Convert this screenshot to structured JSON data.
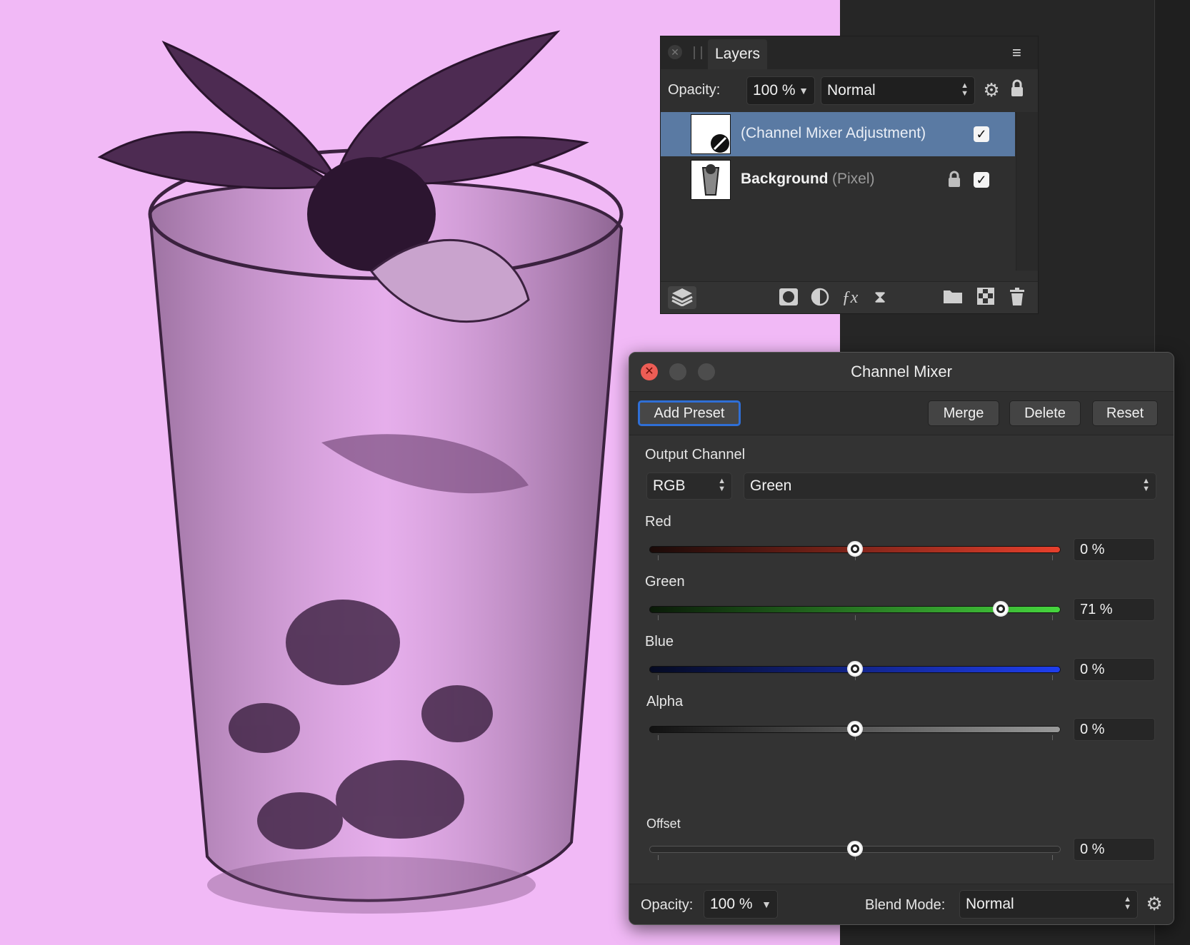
{
  "layers_panel": {
    "tab_label": "Layers",
    "opacity_label": "Opacity:",
    "opacity_value": "100 %",
    "blend_mode": "Normal",
    "layers": [
      {
        "name": "(Channel Mixer Adjustment)",
        "selected": true,
        "visible": true
      },
      {
        "name": "Background",
        "type": "(Pixel)",
        "selected": false,
        "locked": true,
        "visible": true
      }
    ],
    "footer_icons": [
      "layers-icon",
      "mask-icon",
      "adjustment-icon",
      "fx-icon",
      "live-filter-icon",
      "folder-icon",
      "pixel-layer-icon",
      "trash-icon"
    ]
  },
  "channel_mixer": {
    "title": "Channel Mixer",
    "buttons": {
      "add_preset": "Add Preset",
      "merge": "Merge",
      "delete": "Delete",
      "reset": "Reset"
    },
    "output_channel_label": "Output Channel",
    "color_space": "RGB",
    "channel": "Green",
    "sliders": [
      {
        "label": "Red",
        "value_text": "0 %",
        "value": 0,
        "colors": [
          "#1a0a08",
          "#e8402c"
        ]
      },
      {
        "label": "Green",
        "value_text": "71 %",
        "value": 71,
        "colors": [
          "#0a1a08",
          "#46d63e"
        ]
      },
      {
        "label": "Blue",
        "value_text": "0 %",
        "value": 0,
        "colors": [
          "#050a22",
          "#1f3ff0"
        ]
      },
      {
        "label": "Alpha",
        "value_text": "0 %",
        "value": 0,
        "colors": [
          "#111111",
          "#9a9a9a"
        ]
      }
    ],
    "offset": {
      "label": "Offset",
      "value_text": "0 %",
      "value": 0
    },
    "footer": {
      "opacity_label": "Opacity:",
      "opacity_value": "100 %",
      "blend_label": "Blend Mode:",
      "blend_value": "Normal"
    }
  },
  "colors": {
    "canvas_bg": "#f1b9f6",
    "selection": "#5a7aa3",
    "accent_focus": "#2f6fd6",
    "close_red": "#ed5d55"
  }
}
